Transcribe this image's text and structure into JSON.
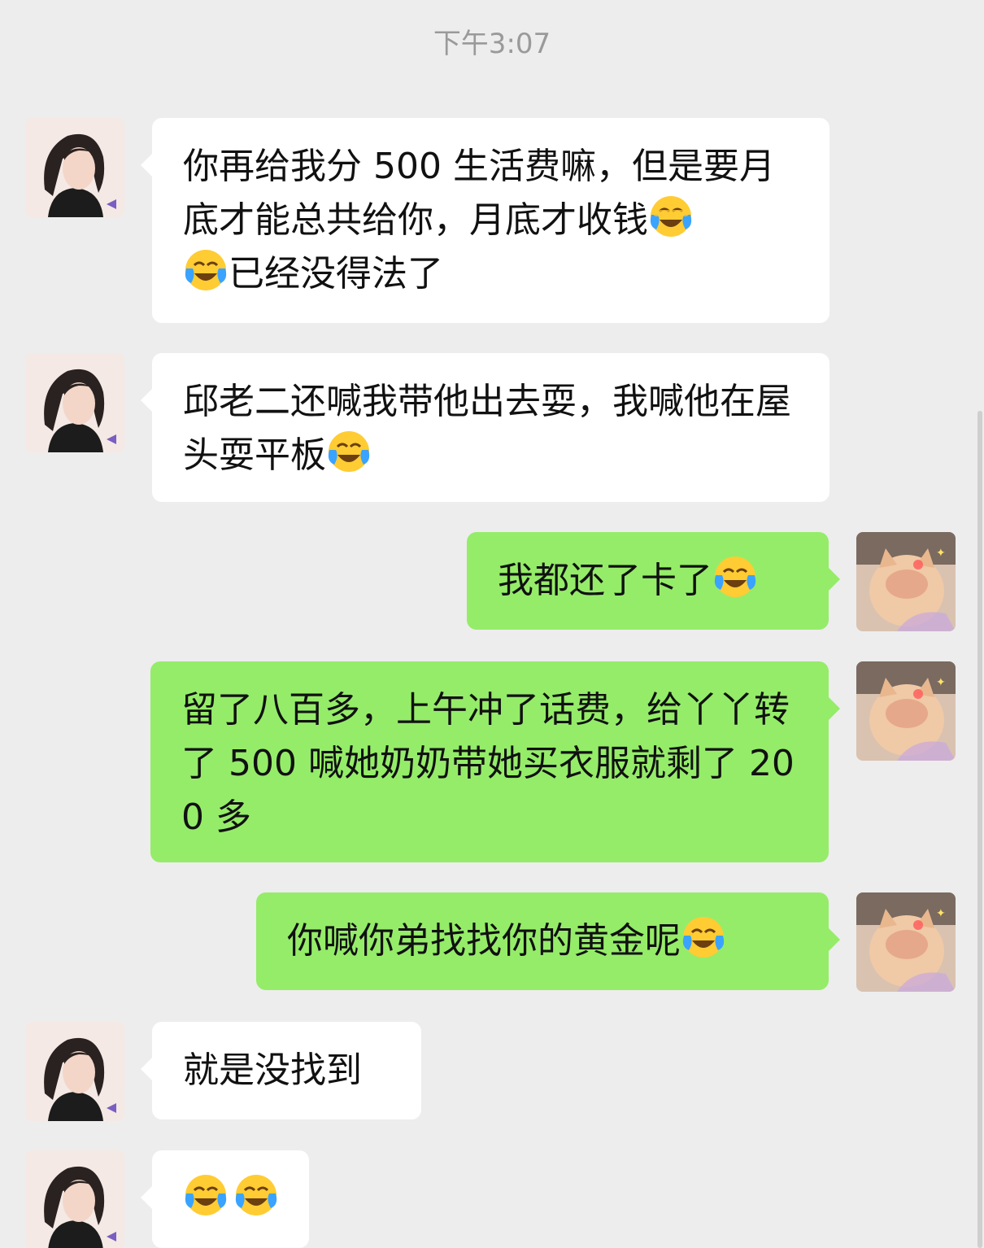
{
  "timestamp": "下午3:07",
  "contact": {
    "avatar_icon": "girl-portrait-avatar",
    "bubble_color": "#ffffff"
  },
  "me": {
    "avatar_icon": "cat-photo-avatar",
    "bubble_color": "#95ec69"
  },
  "emoji_name": "face-with-tears-of-joy-emoji",
  "messages": [
    {
      "sender": "contact",
      "segments": [
        "你再给我分 500 生活费嘛，但是要月底才能总共给你，月底才收钱",
        "",
        "已经没得法了"
      ]
    },
    {
      "sender": "contact",
      "segments": [
        "邱老二还喊我带他出去耍，我喊他在屋头耍平板"
      ]
    },
    {
      "sender": "me",
      "segments": [
        "我都还了卡了"
      ]
    },
    {
      "sender": "me",
      "segments": [
        "留了八百多，上午冲了话费，给丫丫转了 500 喊她奶奶带她买衣服就剩了 200 多"
      ]
    },
    {
      "sender": "me",
      "segments": [
        "你喊你弟找找你的黄金呢"
      ]
    },
    {
      "sender": "contact",
      "segments": [
        "就是没找到"
      ]
    },
    {
      "sender": "contact",
      "segments": [
        "",
        ""
      ]
    }
  ]
}
